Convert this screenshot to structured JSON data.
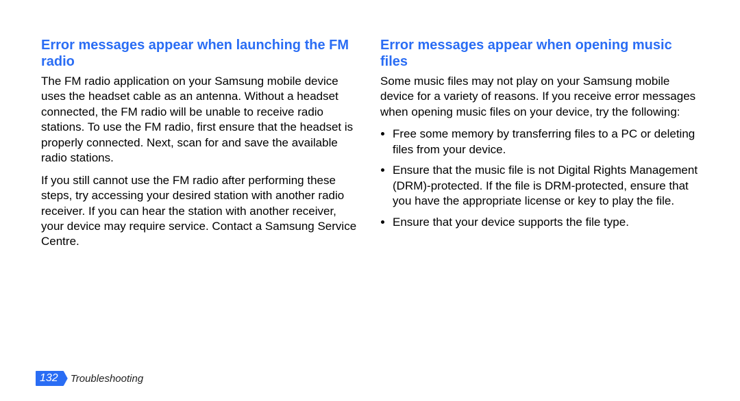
{
  "left": {
    "heading": "Error messages appear when launching the FM radio",
    "p1": "The FM radio application on your Samsung mobile device uses the headset cable as an antenna. Without a headset connected, the FM radio will be unable to receive radio stations. To use the FM radio, first ensure that the headset is properly connected. Next, scan for and save the available radio stations.",
    "p2": "If you still cannot use the FM radio after performing these steps, try accessing your desired station with another radio receiver. If you can hear the station with another receiver, your device may require service. Contact a Samsung Service Centre."
  },
  "right": {
    "heading": "Error messages appear when opening music files",
    "intro": "Some music files may not play on your Samsung mobile device for a variety of reasons. If you receive error messages when opening music files on your device, try the following:",
    "bullets": [
      "Free some memory by transferring files to a PC or deleting files from your device.",
      "Ensure that the music file is not Digital Rights Management (DRM)-protected. If the file is DRM-protected, ensure that you have the appropriate license or key to play the file.",
      "Ensure that your device supports the file type."
    ]
  },
  "footer": {
    "page_number": "132",
    "section": "Troubleshooting"
  }
}
